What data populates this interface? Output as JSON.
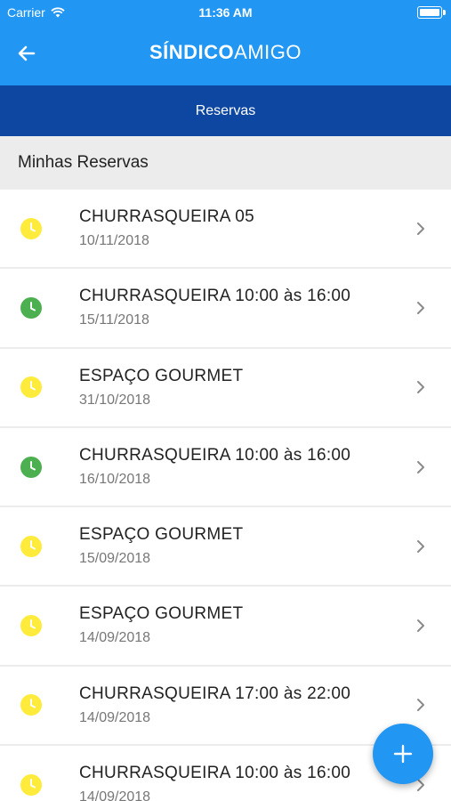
{
  "status_bar": {
    "carrier": "Carrier",
    "time": "11:36 AM"
  },
  "header": {
    "title_bold": "SÍNDICO",
    "title_light": "AMIGO"
  },
  "tab": {
    "label": "Reservas"
  },
  "section": {
    "title": "Minhas Reservas"
  },
  "colors": {
    "primary": "#2196f3",
    "dark": "#0d47a1",
    "pending": "#ffeb3b",
    "approved": "#4caf50"
  },
  "reservations": [
    {
      "title": "CHURRASQUEIRA 05",
      "date": "10/11/2018",
      "status": "pending",
      "icon": "clock-icon-yellow"
    },
    {
      "title": "CHURRASQUEIRA 10:00 às 16:00",
      "date": "15/11/2018",
      "status": "approved",
      "icon": "clock-icon-green"
    },
    {
      "title": "ESPAÇO GOURMET",
      "date": "31/10/2018",
      "status": "pending",
      "icon": "clock-icon-yellow"
    },
    {
      "title": "CHURRASQUEIRA 10:00 às 16:00",
      "date": "16/10/2018",
      "status": "approved",
      "icon": "clock-icon-green"
    },
    {
      "title": "ESPAÇO GOURMET",
      "date": "15/09/2018",
      "status": "pending",
      "icon": "clock-icon-yellow"
    },
    {
      "title": "ESPAÇO GOURMET",
      "date": "14/09/2018",
      "status": "pending",
      "icon": "clock-icon-yellow"
    },
    {
      "title": "CHURRASQUEIRA 17:00 às 22:00",
      "date": "14/09/2018",
      "status": "pending",
      "icon": "clock-icon-yellow"
    },
    {
      "title": "CHURRASQUEIRA 10:00 às 16:00",
      "date": "14/09/2018",
      "status": "pending",
      "icon": "clock-icon-yellow"
    }
  ]
}
